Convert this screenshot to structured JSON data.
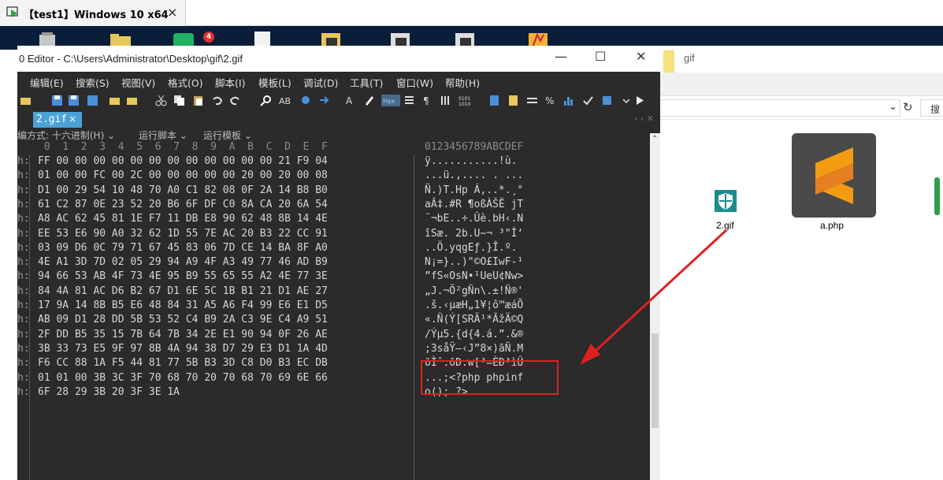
{
  "vm": {
    "title": "【test1】Windows 10 x64",
    "close": "×"
  },
  "notif_badge": "4",
  "explorer": {
    "title": "gif",
    "search_partial": "搜",
    "files": [
      {
        "name": "2.gif"
      },
      {
        "name": "a.php"
      }
    ]
  },
  "editor": {
    "title": "0 Editor - C:\\Users\\Administrator\\Desktop\\gif\\2.gif",
    "min": "—",
    "max": "☐",
    "close": "✕",
    "menu": [
      "编辑(E)",
      "搜索(S)",
      "视图(V)",
      "格式(O)",
      "脚本(I)",
      "模板(L)",
      "调试(D)",
      "工具(T)",
      "窗口(W)",
      "帮助(H)"
    ],
    "tab": "2.gif",
    "tab_close": "×",
    "mode": [
      "编方式: 十六进制(H) ⌄",
      "运行脚本 ⌄",
      "运行模板 ⌄"
    ],
    "ruler_hex": " 0  1  2  3  4  5  6  7  8  9  A  B  C  D  E  F",
    "ruler_ascii": "0123456789ABCDEF",
    "gutter_char": "h:",
    "hex_rows": [
      "FF 00 00 00 00 00 00 00 00 00 00 00 00 21 F9 04",
      "01 00 00 FC 00 2C 00 00 00 00 00 20 00 20 00 08",
      "D1 00 29 54 10 48 70 A0 C1 82 08 0F 2A 14 B8 B0",
      "61 C2 87 0E 23 52 20 B6 6F DF C0 8A CA 20 6A 54",
      "A8 AC 62 45 81 1E F7 11 DB E8 90 62 48 8B 14 4E",
      "EE 53 E6 90 A0 32 62 1D 55 7E AC 20 B3 22 CC 91",
      "03 09 D6 0C 79 71 67 45 83 06 7D CE 14 BA 8F A0",
      "4E A1 3D 7D 02 05 29 94 A9 4F A3 49 77 46 AD B9",
      "94 66 53 AB 4F 73 4E 95 B9 55 65 55 A2 4E 77 3E",
      "84 4A 81 AC D6 B2 67 D1 6E 5C 1B B1 21 D1 AE 27",
      "17 9A 14 8B B5 E6 48 84 31 A5 A6 F4 99 E6 E1 D5",
      "AB 09 D1 28 DD 5B 53 52 C4 B9 2A C3 9E C4 A9 51",
      "2F DD B5 35 15 7B 64 7B 34 2E E1 90 94 0F 26 AE",
      "3B 33 73 E5 9F 97 8B 4A 94 38 D7 29 E3 D1 1A 4D",
      "F6 CC 88 1A F5 44 81 77 5B B3 3D C8 D0 B3 EC DB",
      "01 01 00 3B 3C 3F 70 68 70 20 70 68 70 69 6E 66",
      "6F 28 29 3B 20 3F 3E 1A"
    ],
    "ascii_rows": [
      "ÿ...........!ù.",
      "...ü.,.... . ...",
      "Ñ.)T.Hp Á,..*.¸°",
      "aÂ‡.#R ¶oßÀŠË jT",
      "¨¬bE..÷.Ûè.bH‹.N",
      "îSæ. 2b.U~¬ ³\"Ì‘",
      "..Ö.yqgEƒ.}Î.º.",
      "N¡=}..)\"©O£IwF-¹",
      "”fS«OsN•¹UeU¢Nw>",
      "„J.¬Ö²gÑn\\.±!Ñ®'",
      ".š.‹µæH„1¥¦ô™æáÕ",
      "«.Ñ(Ý[SRÄ¹*ÃžÄ©Q",
      "/Ýµ5.{d{4.á.”.&®",
      ";3såŸ—‹J”8×)ãÑ.M",
      "öÌˆ.õD.w[³=ÈÐ³ìÛ",
      "...;<?php phpinf",
      "o(); ?>."
    ]
  },
  "colors": {
    "editor_bg": "#2b2b2b",
    "tab_blue": "#4aa3d6",
    "highlight_red": "#e02020"
  }
}
